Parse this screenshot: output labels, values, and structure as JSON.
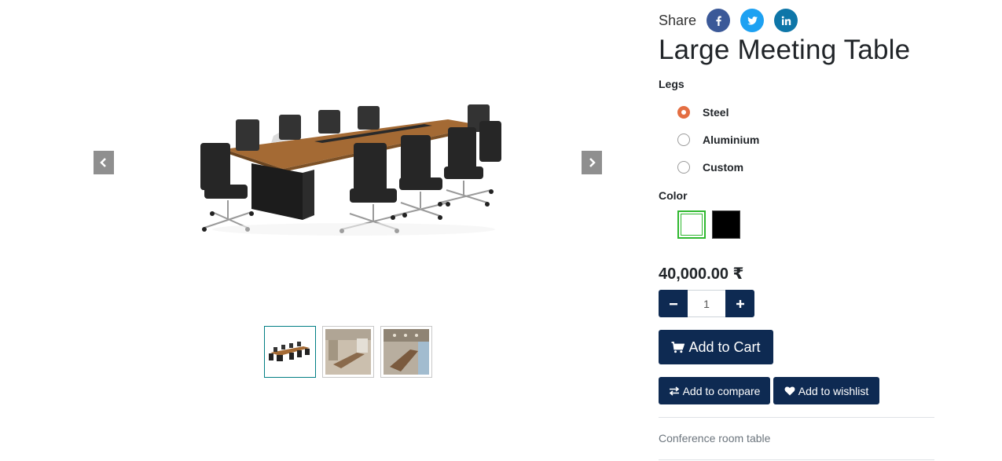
{
  "gallery": {
    "main_image_icon": "meeting-table-image",
    "prev_icon": "chevron-left-icon",
    "next_icon": "chevron-right-icon",
    "thumbnails": [
      {
        "icon": "meeting-table-thumbnail",
        "active": true
      },
      {
        "icon": "conference-room-thumbnail",
        "active": false
      },
      {
        "icon": "conference-room-thumbnail",
        "active": false
      }
    ]
  },
  "share": {
    "label": "Share",
    "networks": [
      {
        "name": "facebook",
        "icon": "facebook-icon",
        "color": "#3b5998"
      },
      {
        "name": "twitter",
        "icon": "twitter-icon",
        "color": "#1da1f2"
      },
      {
        "name": "linkedin",
        "icon": "linkedin-icon",
        "color": "#0e76a8"
      }
    ]
  },
  "product": {
    "title": "Large Meeting Table",
    "price": "40,000.00 ₹",
    "description": "Conference room table"
  },
  "attributes": {
    "legs": {
      "label": "Legs",
      "options": [
        {
          "label": "Steel",
          "selected": true
        },
        {
          "label": "Aluminium",
          "selected": false
        },
        {
          "label": "Custom",
          "selected": false
        }
      ]
    },
    "color": {
      "label": "Color",
      "swatches": [
        {
          "name": "white",
          "hex": "#ffffff",
          "selected": true
        },
        {
          "name": "black",
          "hex": "#000000",
          "selected": false
        }
      ]
    }
  },
  "quantity": {
    "value": "1",
    "minus_icon": "minus-icon",
    "plus_icon": "plus-icon"
  },
  "actions": {
    "add_to_cart": "Add to Cart",
    "add_to_compare": "Add to compare",
    "add_to_wishlist": "Add to wishlist"
  },
  "colors": {
    "primary": "#0e2a52",
    "radio_selected": "#e46e42",
    "swatch_selected_border": "#2fb82f",
    "thumb_active_border": "#017e84"
  }
}
